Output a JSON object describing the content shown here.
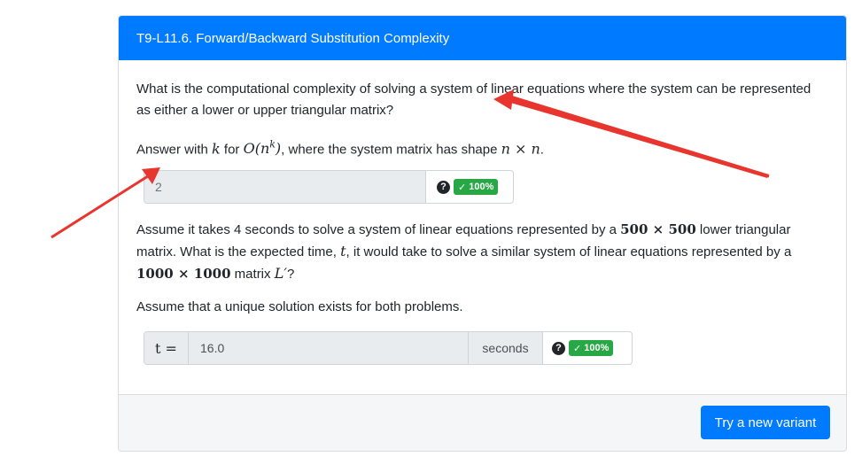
{
  "card": {
    "title": "T9-L11.6. Forward/Backward Substitution Complexity"
  },
  "question1": {
    "text": "What is the computational complexity of solving a system of linear equations where the system can be represented as either a lower or upper triangular matrix?",
    "instr_prefix": "Answer with ",
    "instr_k": "k",
    "instr_for": " for ",
    "instr_O": "O(n",
    "instr_sup": "k",
    "instr_close": ")",
    "instr_suffix": ", where the system matrix has shape ",
    "instr_shape": "n × n",
    "instr_end": "."
  },
  "answer1": {
    "value": "2",
    "help_icon": "?",
    "badge": "100%",
    "badge_icon": "✓"
  },
  "question2": {
    "p1_a": "Assume it takes 4 seconds to solve a system of linear equations represented by a ",
    "p1_dim1": "500 × 500",
    "p1_b": " lower triangular matrix. What is the expected time, ",
    "p1_t": "t",
    "p1_c": ", it would take to solve a similar system of linear equations represented by a ",
    "p1_dim2": "1000 × 1000",
    "p1_d": " matrix ",
    "p1_L": "L′",
    "p1_e": "?",
    "p2": "Assume that a unique solution exists for both problems."
  },
  "answer2": {
    "prefix": "t =",
    "value": "16.0",
    "unit": "seconds",
    "help_icon": "?",
    "badge": "100%",
    "badge_icon": "✓"
  },
  "footer": {
    "button_label": "Try a new variant"
  },
  "colors": {
    "header_blue": "#007bff",
    "badge_green": "#28a745",
    "arrow_red": "#e8352e"
  }
}
